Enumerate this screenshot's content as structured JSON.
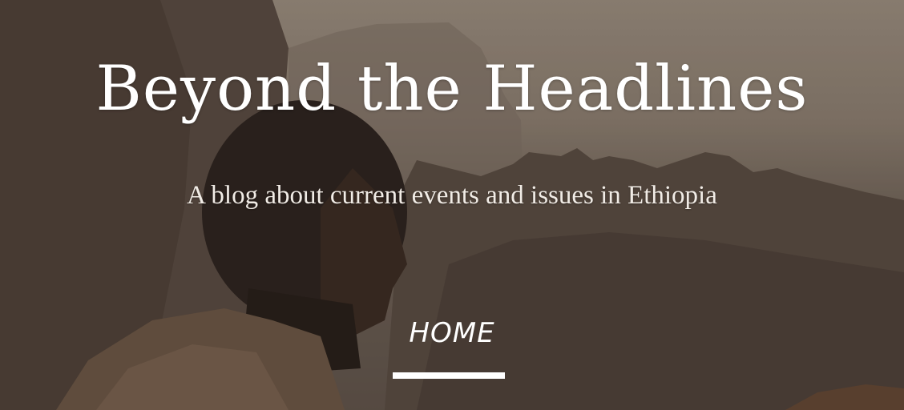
{
  "header": {
    "title": "Beyond the Headlines",
    "subtitle": "A blog about current events and issues in Ethiopia"
  },
  "nav": {
    "items": [
      {
        "label": "HOME",
        "active": true
      }
    ]
  },
  "colors": {
    "text": "#ffffff",
    "underline": "#ffffff"
  }
}
